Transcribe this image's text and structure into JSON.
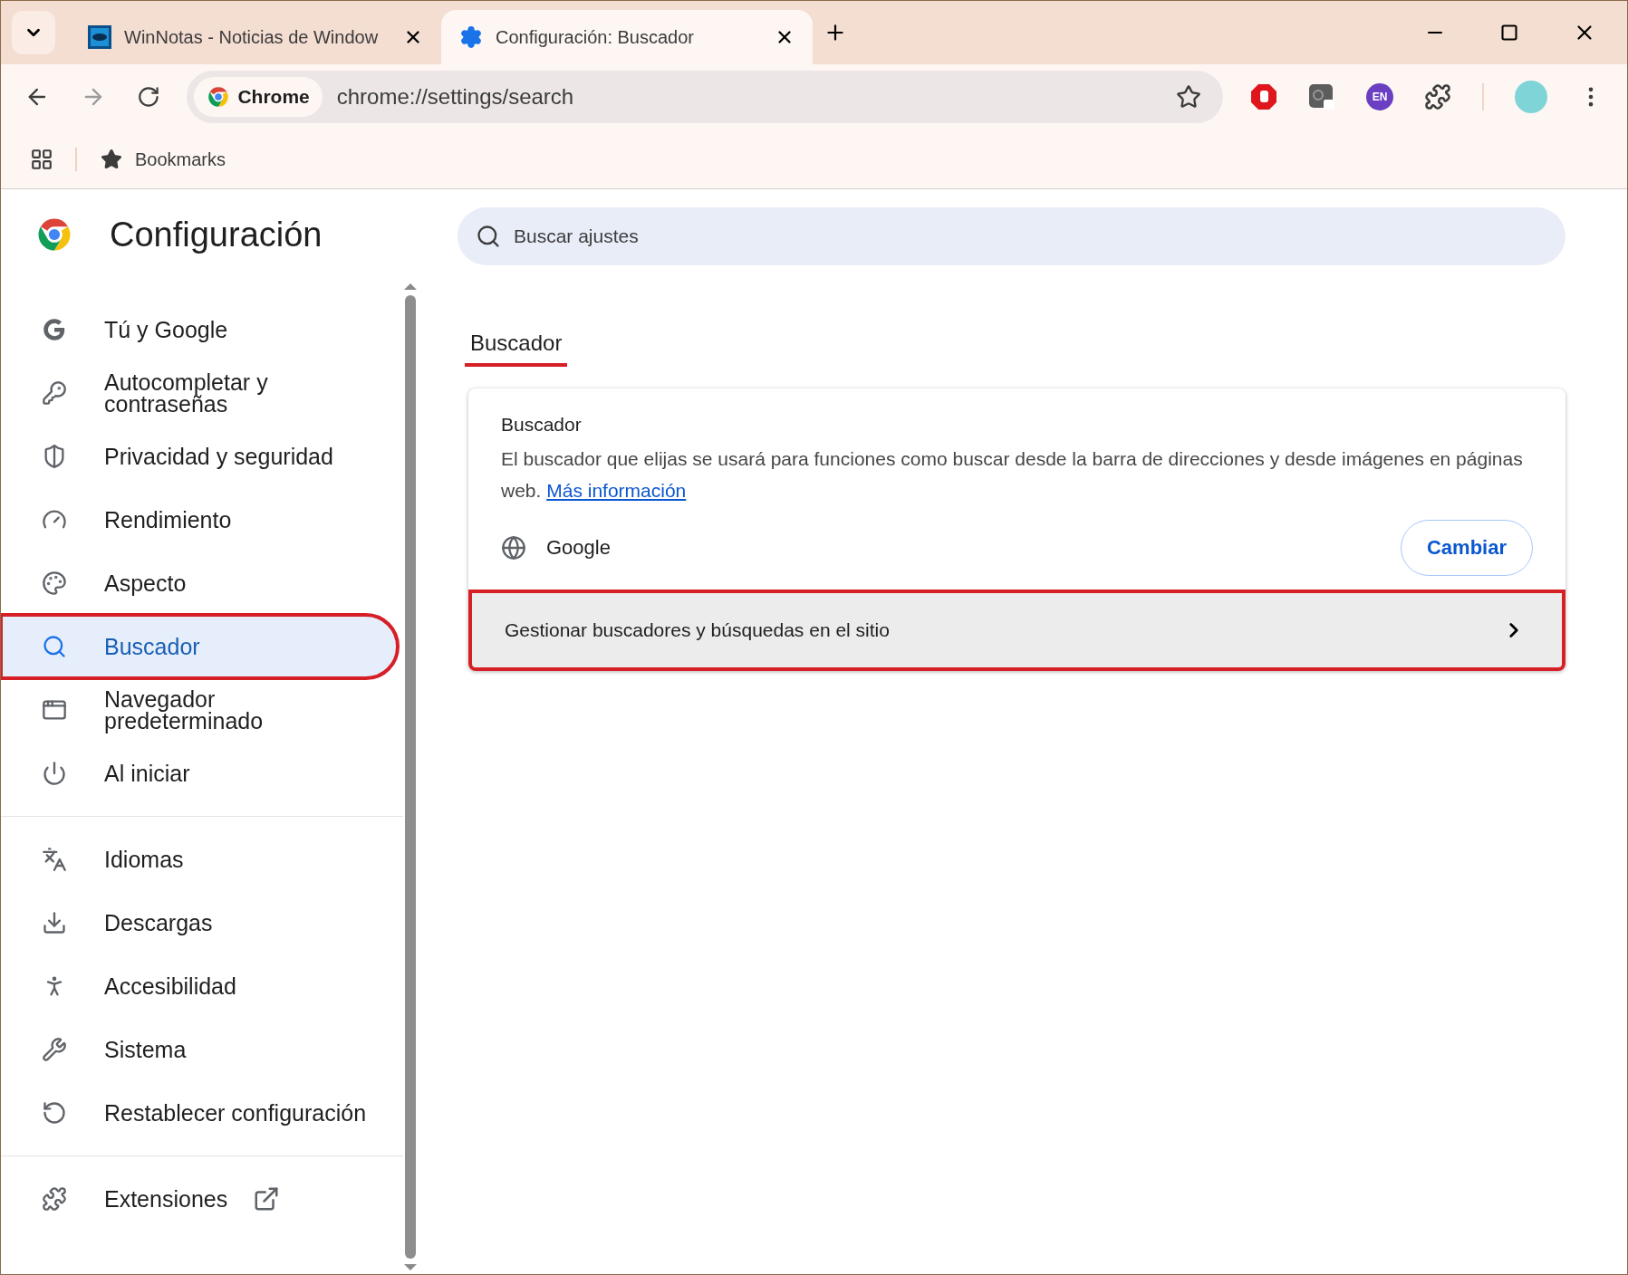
{
  "tabs": [
    {
      "title": "WinNotas - Noticias de Window",
      "selected": false
    },
    {
      "title": "Configuración: Buscador",
      "selected": true
    }
  ],
  "address_bar": {
    "chip": "Chrome",
    "url": "chrome://settings/search",
    "starred": false
  },
  "extension_badge": "EN",
  "bookmarks_bar": {
    "label": "Bookmarks"
  },
  "settings": {
    "title": "Configuración",
    "search_placeholder": "Buscar ajustes",
    "nav_groups": [
      [
        {
          "label": "Tú y Google",
          "selected": false,
          "highlighted": false
        },
        {
          "label": "Autocompletar y contraseñas",
          "selected": false,
          "highlighted": false
        },
        {
          "label": "Privacidad y seguridad",
          "selected": false,
          "highlighted": false
        },
        {
          "label": "Rendimiento",
          "selected": false,
          "highlighted": false
        },
        {
          "label": "Aspecto",
          "selected": false,
          "highlighted": false
        },
        {
          "label": "Buscador",
          "selected": true,
          "highlighted": true
        },
        {
          "label": "Navegador predeterminado",
          "selected": false,
          "highlighted": false
        },
        {
          "label": "Al iniciar",
          "selected": false,
          "highlighted": false
        }
      ],
      [
        {
          "label": "Idiomas",
          "selected": false,
          "highlighted": false
        },
        {
          "label": "Descargas",
          "selected": false,
          "highlighted": false
        },
        {
          "label": "Accesibilidad",
          "selected": false,
          "highlighted": false
        },
        {
          "label": "Sistema",
          "selected": false,
          "highlighted": false
        },
        {
          "label": "Restablecer configuración",
          "selected": false,
          "highlighted": false
        }
      ],
      [
        {
          "label": "Extensiones",
          "selected": false,
          "highlighted": false,
          "external": true
        }
      ]
    ],
    "section": {
      "heading": "Buscador",
      "card": {
        "title": "Buscador",
        "description": "El buscador que elijas se usará para funciones como buscar desde la barra de direcciones y desde imágenes en páginas web.",
        "link": "Más información",
        "engine": "Google",
        "button": "Cambiar",
        "manage_row": {
          "label": "Gestionar buscadores y búsquedas en el sitio",
          "highlighted": true
        }
      }
    }
  }
}
